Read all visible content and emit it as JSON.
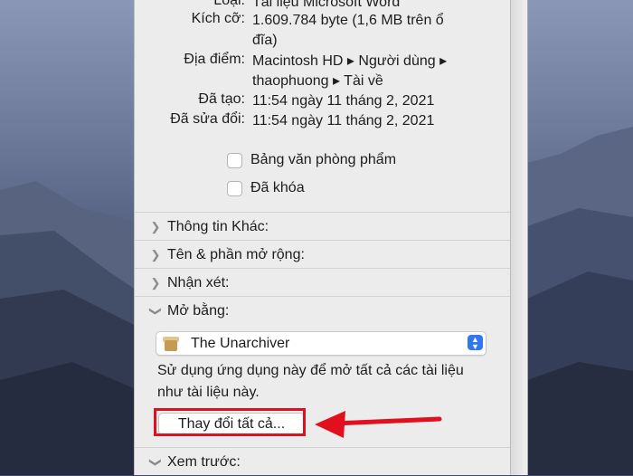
{
  "info": {
    "type_label": "Loại:",
    "type_value": "Tài liệu Microsoft Word",
    "size_label": "Kích cỡ:",
    "size_value": "1.609.784 byte (1,6 MB trên ổ đĩa)",
    "where_label": "Địa điểm:",
    "where_value": "Macintosh HD ▸ Người dùng ▸ thaophuong ▸ Tài về",
    "created_label": "Đã tạo:",
    "created_value": "11:54 ngày 11 tháng 2, 2021",
    "modified_label": "Đã sửa đổi:",
    "modified_value": "11:54 ngày 11 tháng 2, 2021"
  },
  "checkboxes": {
    "stationery": "Bảng văn phòng phẩm",
    "locked": "Đã khóa"
  },
  "sections": {
    "more_info": "Thông tin Khác:",
    "name_ext": "Tên & phần mở rộng:",
    "comments": "Nhận xét:",
    "open_with": "Mở bằng:",
    "preview": "Xem trước:"
  },
  "open_with": {
    "selected_app": "The Unarchiver",
    "description": "Sử dụng ứng dụng này để mở tất cả các tài liệu như tài liệu này.",
    "change_all_button": "Thay đổi tất cả..."
  },
  "colors": {
    "highlight": "#e0101e",
    "accent": "#2f78f0"
  }
}
